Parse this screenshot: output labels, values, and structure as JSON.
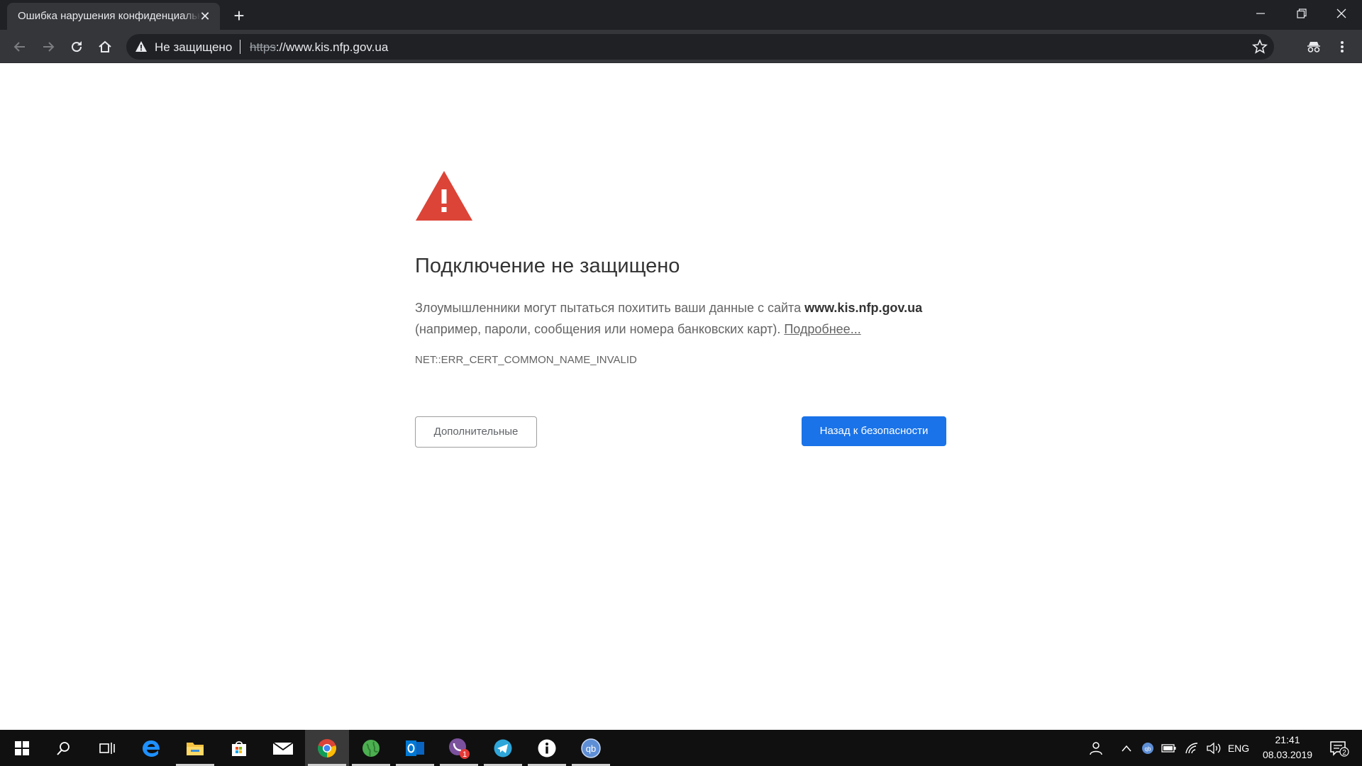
{
  "browser": {
    "tab_title": "Ошибка нарушения конфиденциальности",
    "tab_close": "✕",
    "new_tab": "+",
    "security_status": "Не защищено",
    "url_scheme": "https",
    "url_rest": "://www.kis.nfp.gov.ua"
  },
  "page": {
    "headline": "Подключение не защищено",
    "desc_part1": "Злоумышленники могут пытаться похитить ваши данные с сайта ",
    "desc_domain": "www.kis.nfp.gov.ua",
    "desc_part2": " (например, пароли, сообщения или номера банковских карт). ",
    "learn_more": "Подробнее...",
    "error_code": "NET::ERR_CERT_COMMON_NAME_INVALID",
    "advanced_button": "Дополнительные",
    "back_button": "Назад к безопасности"
  },
  "taskbar": {
    "language": "ENG",
    "time": "21:41",
    "date": "08.03.2019",
    "notification_count": "2",
    "viber_badge": "1",
    "pinned_apps": [
      "search",
      "task-view",
      "edge",
      "file-explorer",
      "store",
      "mail",
      "chrome",
      "vpn-globe",
      "outlook",
      "viber",
      "telegram",
      "info-app",
      "qbittorrent"
    ]
  },
  "colors": {
    "primary_button": "#1a73e8",
    "warning_red": "#db4437",
    "chrome_dark": "#35363a"
  }
}
